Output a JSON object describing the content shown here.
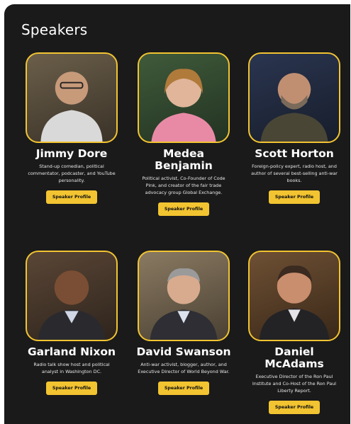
{
  "section": {
    "title": "Speakers"
  },
  "accent_color": "#f2c431",
  "speakers": [
    {
      "name": "Jimmy Dore",
      "bio": "Stand-up comedian, political commentator, podcaster, and YouTube personality.",
      "button": "Speaker Profile",
      "photo": "portrait"
    },
    {
      "name": "Medea\nBenjamin",
      "bio": "Political activist, Co-Founder of Code Pink, and creator of the fair trade advocacy group Global Exchange.",
      "button": "Speaker Profile",
      "photo": "portrait"
    },
    {
      "name": "Scott Horton",
      "bio": "Foreign-policy expert, radio host, and author of several best-selling anti-war books.",
      "button": "Speaker Profile",
      "photo": "portrait"
    },
    {
      "name": "Garland Nixon",
      "bio": "Radio talk show host and political analyst in Washington DC.",
      "button": "Speaker Profile",
      "photo": "portrait"
    },
    {
      "name": "David Swanson",
      "bio": "Anti-war activist, blogger, author, and Executive Director of World Beyond War.",
      "button": "Speaker Profile",
      "photo": "portrait"
    },
    {
      "name": "Daniel\nMcAdams",
      "bio": "Executive Director of the Ron Paul Institute and Co-Host of the Ron Paul Liberty Report.",
      "button": "Speaker Profile",
      "photo": "portrait"
    }
  ]
}
